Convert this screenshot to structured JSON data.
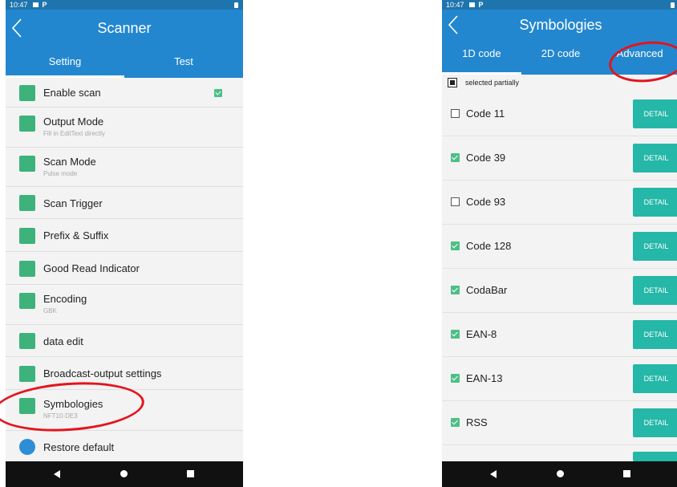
{
  "left_screen": {
    "status_time": "10:47",
    "status_p": "P",
    "title": "Scanner",
    "tabs": [
      "Setting",
      "Test"
    ],
    "items": [
      {
        "label": "Enable scan",
        "sub": "",
        "checked": true,
        "icon": "barcode-scan-icon"
      },
      {
        "label": "Output Mode",
        "sub": "Fill in EditText directly",
        "icon": "output-arrow-icon"
      },
      {
        "label": "Scan Mode",
        "sub": "Pulse mode",
        "icon": "scan-mode-icon"
      },
      {
        "label": "Scan Trigger",
        "sub": "",
        "icon": "trigger-icon"
      },
      {
        "label": "Prefix & Suffix",
        "sub": "",
        "icon": "prefix-suffix-icon"
      },
      {
        "label": "Good Read Indicator",
        "sub": "",
        "icon": "indicator-icon"
      },
      {
        "label": "Encoding",
        "sub": "GBK",
        "icon": "encoding-icon"
      },
      {
        "label": "data edit",
        "sub": "",
        "icon": "data-edit-icon"
      },
      {
        "label": "Broadcast-output settings",
        "sub": "",
        "icon": "broadcast-icon"
      },
      {
        "label": "Symbologies",
        "sub": "NFT10-DE3",
        "icon": "symbologies-icon"
      },
      {
        "label": "Restore default",
        "sub": "",
        "icon": "restore-clock-icon"
      }
    ]
  },
  "right_screen": {
    "status_time": "10:47",
    "status_p": "P",
    "title": "Symbologies",
    "tabs": [
      "1D code",
      "2D code",
      "Advanced"
    ],
    "selected_label": "selected partially",
    "detail_label": "DETAIL",
    "codes": [
      {
        "name": "Code 11",
        "checked": false
      },
      {
        "name": "Code 39",
        "checked": true
      },
      {
        "name": "Code 93",
        "checked": false
      },
      {
        "name": "Code 128",
        "checked": true
      },
      {
        "name": "CodaBar",
        "checked": true
      },
      {
        "name": "EAN-8",
        "checked": true
      },
      {
        "name": "EAN-13",
        "checked": true
      },
      {
        "name": "RSS",
        "checked": true
      }
    ]
  },
  "colors": {
    "appbar": "#2387cf",
    "statusbar": "#1e74ad",
    "accent_green": "#3db27a",
    "detail_button": "#25b7a7",
    "highlight": "#e4141e"
  }
}
